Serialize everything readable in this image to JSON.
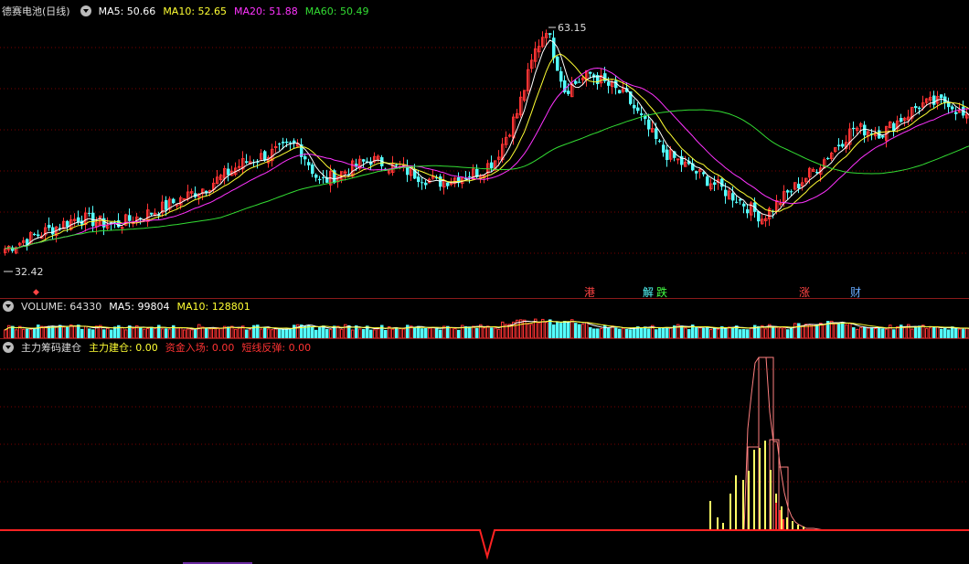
{
  "price_panel": {
    "title": "德赛电池(日线)",
    "ma5_label": "MA5: 50.66",
    "ma10_label": "MA10: 52.65",
    "ma20_label": "MA20: 51.88",
    "ma60_label": "MA60: 50.49",
    "high_label": "63.15",
    "low_label": "32.42",
    "events": [
      "港",
      "解",
      "跌",
      "涨",
      "财"
    ]
  },
  "volume_panel": {
    "title": "VOLUME: 64330",
    "ma5_label": "MA5: 99804",
    "ma10_label": "MA10: 128801"
  },
  "indicator_panel": {
    "title": "主力筹码建仓",
    "l1": "主力建仓: 0.00",
    "l2": "资金入场: 0.00",
    "l3": "短线反弹: 0.00"
  },
  "colors": {
    "up": "#ff3333",
    "down": "#54ffff",
    "ma5": "#ffffff",
    "ma10": "#ffff33",
    "ma20": "#ff33ff",
    "ma60": "#33dd33",
    "grid": "#7a0000"
  },
  "chart_data": [
    {
      "type": "candlestick",
      "high": 63.15,
      "low": 32.42,
      "anchors": [
        [
          0,
          34.5
        ],
        [
          10,
          36.5
        ],
        [
          20,
          38.5
        ],
        [
          30,
          37.5
        ],
        [
          42,
          39.5
        ],
        [
          55,
          42.5
        ],
        [
          65,
          45.5
        ],
        [
          80,
          48
        ],
        [
          86,
          43
        ],
        [
          100,
          46
        ],
        [
          110,
          44.5
        ],
        [
          118,
          43
        ],
        [
          130,
          44.5
        ],
        [
          134,
          46
        ],
        [
          140,
          52
        ],
        [
          145,
          60
        ],
        [
          148,
          63
        ],
        [
          153,
          55
        ],
        [
          160,
          57
        ],
        [
          170,
          54
        ],
        [
          180,
          47
        ],
        [
          190,
          44
        ],
        [
          200,
          41
        ],
        [
          207,
          38.5
        ],
        [
          215,
          42
        ],
        [
          222,
          45
        ],
        [
          232,
          50
        ],
        [
          240,
          49.5
        ],
        [
          250,
          53
        ],
        [
          258,
          53.5
        ],
        [
          264,
          50.5
        ]
      ]
    },
    {
      "type": "bar",
      "series": [
        {
          "name": "VOLUME",
          "values": []
        }
      ]
    },
    {
      "type": "bar",
      "series": [
        {
          "name": "主力建仓",
          "values": []
        }
      ]
    }
  ]
}
